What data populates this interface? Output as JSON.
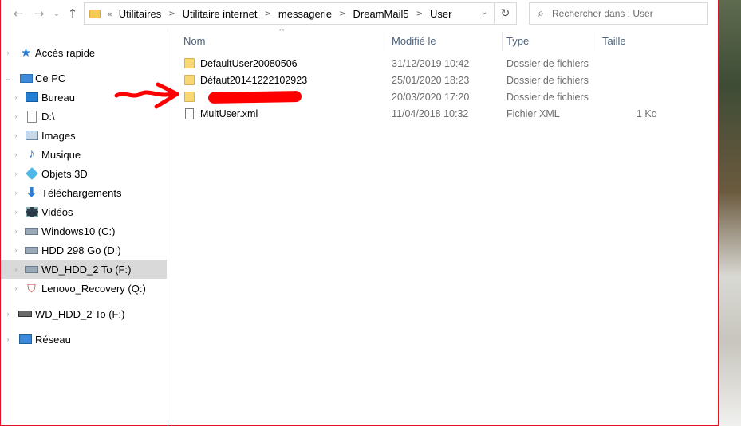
{
  "navbar": {
    "back_icon": "arrow-left-icon",
    "forward_icon": "arrow-right-icon",
    "recent_icon": "chevron-down-icon",
    "up_icon": "arrow-up-icon",
    "overflow": "«",
    "breadcrumbs": [
      "Utilitaires",
      "Utilitaire internet",
      "messagerie",
      "DreamMail5",
      "User"
    ],
    "search_placeholder": "Rechercher dans : User"
  },
  "sidebar": {
    "items": [
      {
        "label": "Accès rapide",
        "icon": "star-icon"
      },
      {
        "label": "Ce PC",
        "icon": "computer-icon"
      },
      {
        "label": "Bureau",
        "icon": "desktop-icon"
      },
      {
        "label": "D:\\",
        "icon": "file-icon"
      },
      {
        "label": "Images",
        "icon": "images-icon"
      },
      {
        "label": "Musique",
        "icon": "music-icon"
      },
      {
        "label": "Objets 3D",
        "icon": "cube-icon"
      },
      {
        "label": "Téléchargements",
        "icon": "download-icon"
      },
      {
        "label": "Vidéos",
        "icon": "video-icon"
      },
      {
        "label": "Windows10 (C:)",
        "icon": "drive-icon"
      },
      {
        "label": "HDD 298 Go (D:)",
        "icon": "drive-icon"
      },
      {
        "label": "WD_HDD_2 To (F:)",
        "icon": "drive-icon"
      },
      {
        "label": "Lenovo_Recovery (Q:)",
        "icon": "recovery-drive-icon"
      },
      {
        "label": "WD_HDD_2 To (F:)",
        "icon": "removable-drive-icon"
      },
      {
        "label": "Réseau",
        "icon": "network-icon"
      }
    ]
  },
  "columns": {
    "name": "Nom",
    "modified": "Modifié le",
    "type": "Type",
    "size": "Taille"
  },
  "files": [
    {
      "name": "DefaultUser20080506",
      "modified": "31/12/2019 10:42",
      "type": "Dossier de fichiers",
      "size": ""
    },
    {
      "name": "Défaut20141222102923",
      "modified": "25/01/2020 18:23",
      "type": "Dossier de fichiers",
      "size": ""
    },
    {
      "name": "",
      "modified": "20/03/2020 17:20",
      "type": "Dossier de fichiers",
      "size": ""
    },
    {
      "name": "MultUser.xml",
      "modified": "11/04/2018 10:32",
      "type": "Fichier XML",
      "size": "1 Ko"
    }
  ],
  "colors": {
    "accent": "#0078d7",
    "annotation": "#ff0000",
    "selection": "#d9d9d9"
  }
}
